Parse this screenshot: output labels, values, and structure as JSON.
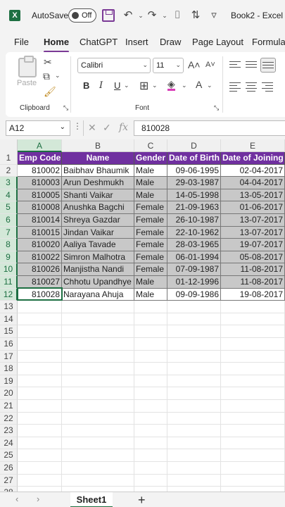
{
  "titlebar": {
    "autosave_label": "AutoSave",
    "autosave_state": "Off",
    "title": "Book2 - Excel"
  },
  "tabs": [
    "File",
    "Home",
    "ChatGPT",
    "Insert",
    "Draw",
    "Page Layout",
    "Formula"
  ],
  "ribbon": {
    "clipboard_label": "Clipboard",
    "paste_label": "Paste",
    "font_label": "Font",
    "font_name": "Calibri",
    "font_size": "11",
    "bold": "B",
    "italic": "I",
    "underline": "U"
  },
  "formula_bar": {
    "name_box": "A12",
    "value": "810028"
  },
  "columns": [
    "A",
    "B",
    "C",
    "D",
    "E"
  ],
  "header_row": [
    "Emp Code",
    "Name",
    "Gender",
    "Date of Birth",
    "Date of Joining"
  ],
  "rows": [
    [
      "810002",
      "Baibhav Bhaumik",
      "Male",
      "09-06-1995",
      "02-04-2017"
    ],
    [
      "810003",
      "Arun Deshmukh",
      "Male",
      "29-03-1987",
      "04-04-2017"
    ],
    [
      "810005",
      "Shanti Vaikar",
      "Male",
      "14-05-1998",
      "13-05-2017"
    ],
    [
      "810008",
      "Anushka Bagchi",
      "Female",
      "21-09-1963",
      "01-06-2017"
    ],
    [
      "810014",
      "Shreya Gazdar",
      "Female",
      "26-10-1987",
      "13-07-2017"
    ],
    [
      "810015",
      "Jindan Vaikar",
      "Female",
      "22-10-1962",
      "13-07-2017"
    ],
    [
      "810020",
      "Aaliya Tavade",
      "Female",
      "28-03-1965",
      "19-07-2017"
    ],
    [
      "810022",
      "Simron Malhotra",
      "Female",
      "06-01-1994",
      "05-08-2017"
    ],
    [
      "810026",
      "Manjistha Nandi",
      "Female",
      "07-09-1987",
      "11-08-2017"
    ],
    [
      "810027",
      "Chhotu Upandhye",
      "Male",
      "01-12-1996",
      "11-08-2017"
    ],
    [
      "810028",
      "Narayana Ahuja",
      "Male",
      "09-09-1986",
      "19-08-2017"
    ]
  ],
  "row_numbers": [
    "1",
    "2",
    "3",
    "4",
    "5",
    "6",
    "7",
    "8",
    "9",
    "10",
    "11",
    "12",
    "13",
    "14",
    "15",
    "16",
    "17",
    "18",
    "19",
    "20",
    "21",
    "22",
    "23",
    "24",
    "25",
    "26",
    "27",
    "28"
  ],
  "sheet": {
    "active_tab": "Sheet1",
    "add_label": "+"
  }
}
